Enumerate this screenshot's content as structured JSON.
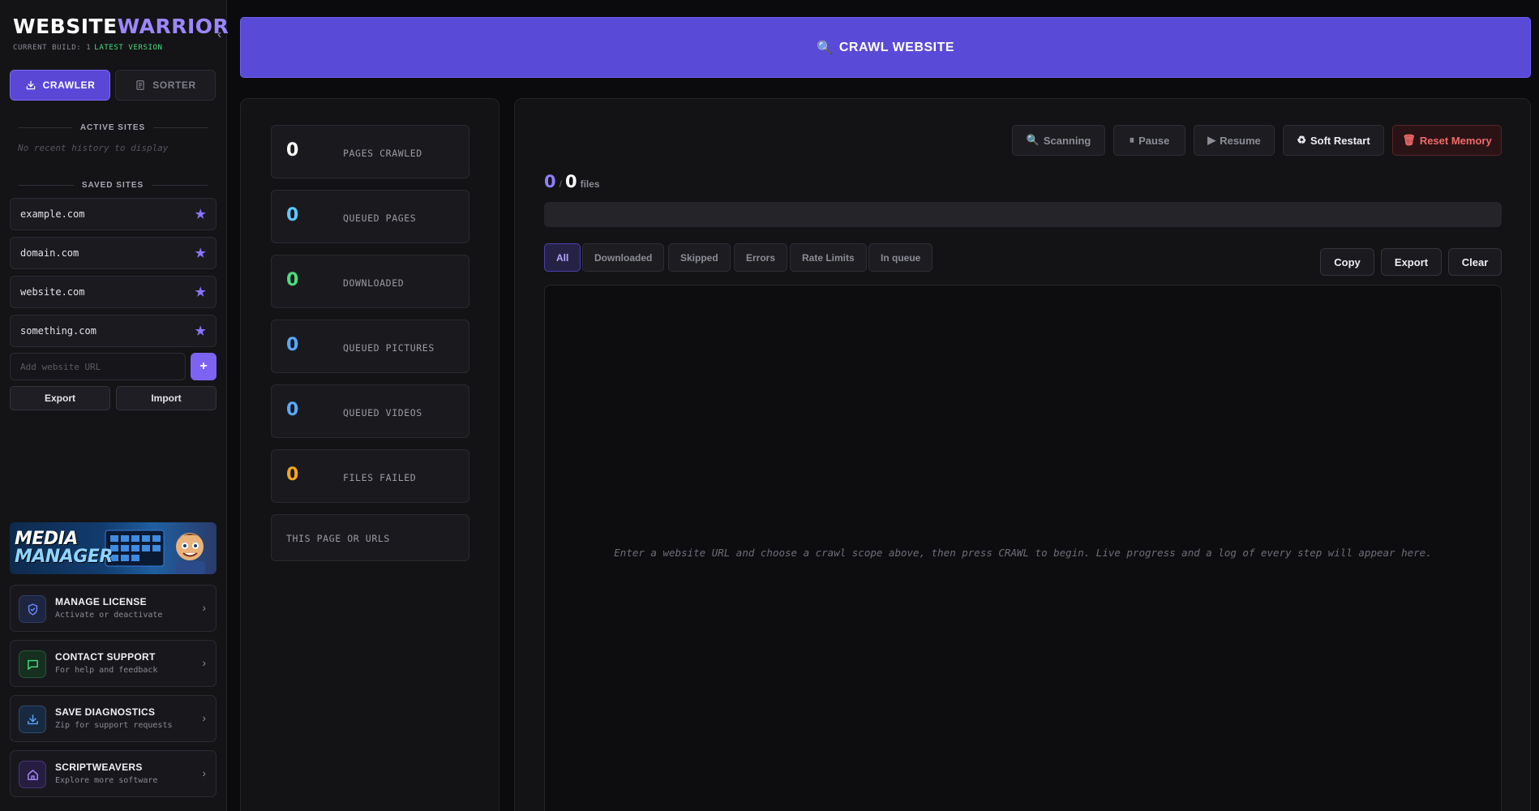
{
  "brand": {
    "name_a": "WEBSITE",
    "name_b": "WARRIOR",
    "build_label": "CURRENT BUILD: 1",
    "version_label": "LATEST VERSION"
  },
  "sidebar": {
    "tabs": [
      {
        "label": "CRAWLER",
        "active": true
      },
      {
        "label": "SORTER",
        "active": false
      }
    ],
    "active_sites": {
      "heading": "ACTIVE SITES",
      "empty": "No recent history to display"
    },
    "saved_sites": {
      "heading": "SAVED SITES",
      "items": [
        {
          "label": "example.com"
        },
        {
          "label": "domain.com"
        },
        {
          "label": "website.com"
        },
        {
          "label": "something.com"
        }
      ]
    },
    "add_url": {
      "placeholder": "Add website URL",
      "value": "",
      "button": "+"
    },
    "export_label": "Export",
    "import_label": "Import",
    "promo": {
      "line1": "MEDIA",
      "line2": "MANAGER"
    },
    "links": [
      {
        "title": "MANAGE LICENSE",
        "subtitle": "Activate or deactivate",
        "icon": "shield-icon",
        "color": "#6b8cff"
      },
      {
        "title": "CONTACT SUPPORT",
        "subtitle": "For help and feedback",
        "icon": "chat-icon",
        "color": "#4ade80"
      },
      {
        "title": "SAVE DIAGNOSTICS",
        "subtitle": "Zip for support requests",
        "icon": "download-icon",
        "color": "#60a5fa"
      },
      {
        "title": "SCRIPTWEAVERS",
        "subtitle": "Explore more software",
        "icon": "home-icon",
        "color": "#a78bfa"
      }
    ]
  },
  "header": {
    "title": "CRAWL WEBSITE",
    "icon": "magnifier-icon"
  },
  "stats": [
    {
      "value": "0",
      "label": "PAGES CRAWLED",
      "color": "#ffffff"
    },
    {
      "value": "0",
      "label": "QUEUED PAGES",
      "color": "#5ec8ff"
    },
    {
      "value": "0",
      "label": "DOWNLOADED",
      "color": "#4ade80"
    },
    {
      "value": "0",
      "label": "QUEUED PICTURES",
      "color": "#5aa8ff"
    },
    {
      "value": "0",
      "label": "QUEUED VIDEOS",
      "color": "#5aa8ff"
    },
    {
      "value": "0",
      "label": "FILES FAILED",
      "color": "#f5a524"
    }
  ],
  "this_page_label": "THIS PAGE OR URLS",
  "controls": {
    "scanning": "Scanning",
    "pause": "Pause",
    "resume": "Resume",
    "soft_restart": "Soft Restart",
    "reset_memory": "Reset Memory"
  },
  "counter": {
    "done": "0",
    "sep": "/",
    "total": "0",
    "unit": "files"
  },
  "progress_percent": 0,
  "filters": [
    {
      "label": "All",
      "active": true
    },
    {
      "label": "Downloaded"
    },
    {
      "label": "Skipped"
    },
    {
      "label": "Errors"
    },
    {
      "label": "Rate Limits"
    },
    {
      "label": "In queue"
    }
  ],
  "log_actions": {
    "copy": "Copy",
    "export": "Export",
    "clear": "Clear"
  },
  "log": {
    "empty_message": "Enter a website URL and choose a crawl scope above, then press CRAWL to begin. Live progress and a log of every step will appear here."
  },
  "colors": {
    "accent": "#5a4ad8",
    "danger": "#ef6b6b"
  }
}
